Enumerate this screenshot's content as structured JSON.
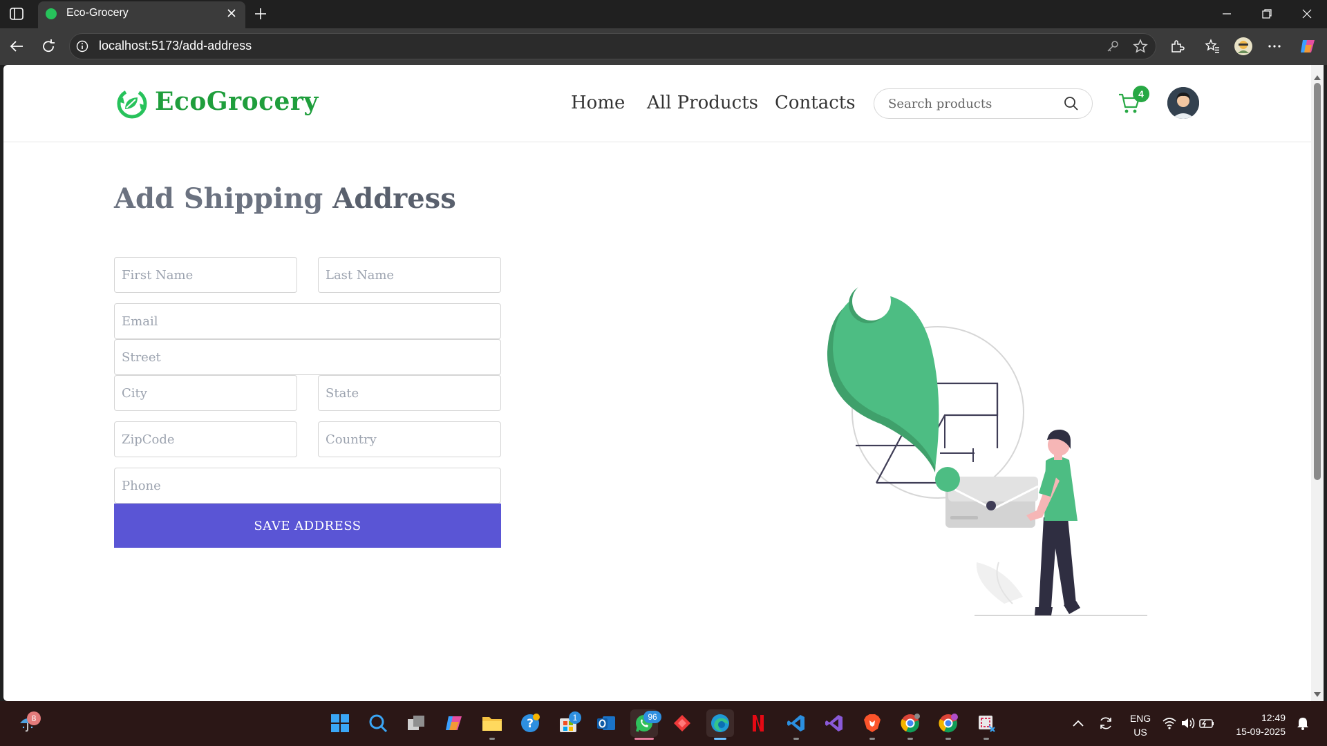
{
  "browser": {
    "tab_title": "Eco-Grocery",
    "url": "localhost:5173/add-address"
  },
  "site": {
    "logo_text": "EcoGrocery",
    "nav": [
      "Home",
      "All Products",
      "Contacts"
    ],
    "search_placeholder": "Search products",
    "cart_count": "4"
  },
  "form": {
    "title_light": "Add Shipping",
    "title_bold": "Address",
    "placeholders": {
      "first_name": "First Name",
      "last_name": "Last Name",
      "email": "Email",
      "street": "Street",
      "city": "City",
      "state": "State",
      "zipcode": "ZipCode",
      "country": "Country",
      "phone": "Phone"
    },
    "submit_label": "SAVE ADDRESS"
  },
  "taskbar": {
    "weather_badge": "8",
    "store_badge": "1",
    "whatsapp_badge": "96",
    "language": "ENG",
    "region": "US",
    "time": "12:49",
    "date": "15-09-2025"
  },
  "colors": {
    "brand_green": "#1f9e3c",
    "button_purple": "#5a55d5",
    "illustration_green": "#4dbd83"
  }
}
